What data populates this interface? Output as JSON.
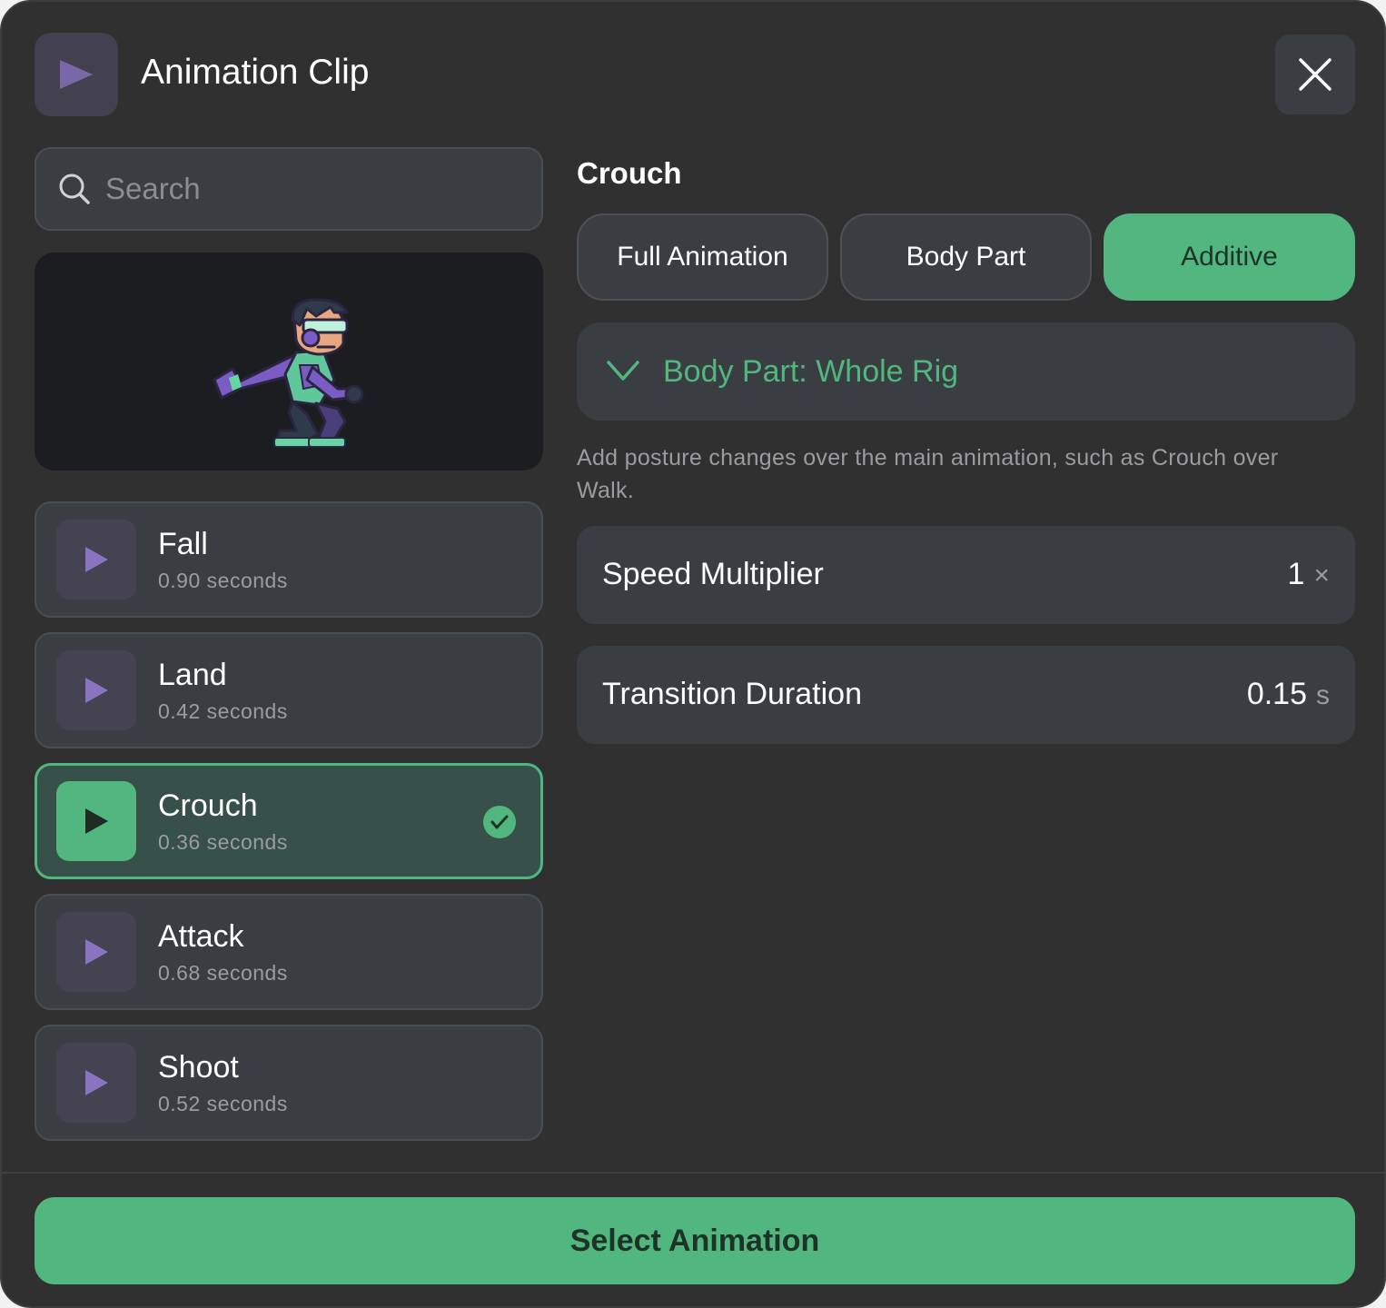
{
  "header": {
    "title": "Animation Clip",
    "app_icon": "play-icon",
    "close_icon": "close-icon"
  },
  "search": {
    "placeholder": "Search",
    "value": "",
    "icon": "search-icon"
  },
  "clips": [
    {
      "name": "Fall",
      "duration": "0.90 seconds",
      "selected": false
    },
    {
      "name": "Land",
      "duration": "0.42 seconds",
      "selected": false
    },
    {
      "name": "Crouch",
      "duration": "0.36 seconds",
      "selected": true
    },
    {
      "name": "Attack",
      "duration": "0.68 seconds",
      "selected": false
    },
    {
      "name": "Shoot",
      "duration": "0.52 seconds",
      "selected": false
    }
  ],
  "detail": {
    "title": "Crouch",
    "modes": [
      {
        "label": "Full Animation",
        "active": false
      },
      {
        "label": "Body Part",
        "active": false
      },
      {
        "label": "Additive",
        "active": true
      }
    ],
    "body_part_dropdown": "Body Part: Whole Rig",
    "description": "Add posture changes over the main animation, such as Crouch over Walk.",
    "speed": {
      "label": "Speed Multiplier",
      "value": "1",
      "unit": "×"
    },
    "transition": {
      "label": "Transition Duration",
      "value": "0.15",
      "unit": "s"
    }
  },
  "footer": {
    "primary_label": "Select Animation"
  },
  "colors": {
    "accent": "#52b77f",
    "background": "#303030",
    "surface": "#3a3e43",
    "thumb_purple": "#7a67a8"
  }
}
